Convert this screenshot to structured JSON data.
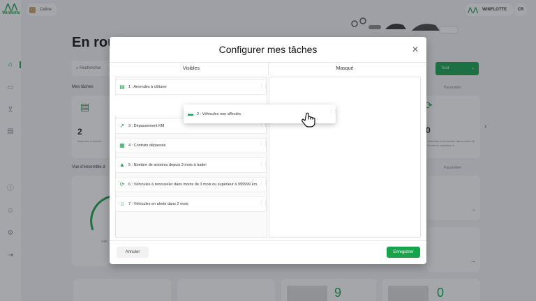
{
  "app": {
    "logo_text": "Winflotte",
    "company": "Celine",
    "user_name": "WINFLOTTE",
    "user_initials": "CR"
  },
  "background": {
    "title": "En rou",
    "search_placeholder": "Rechercher",
    "filter_value": "Tout",
    "section_tasks": "Mes tâches",
    "section_overview": "Vue d'ensemble d",
    "parametrer": "Paramétrer",
    "card1_number": "2",
    "card1_caption": "Amendes à clôturer",
    "card2_number": "0",
    "card2_caption": "Véhicules à renouveler dans moins de 3 mois ou supérieur à",
    "gauge_label": "Véh",
    "stat1_number": "9",
    "stat2_number": "0"
  },
  "modal": {
    "title": "Configurer mes tâches",
    "close_icon": "close-icon",
    "col_visible": "Visibles",
    "col_hidden": "Masqué",
    "cancel_label": "Annuler",
    "save_label": "Enregistrer",
    "visible_tasks": [
      {
        "label": "1 : Amendes à clôturer",
        "icon": "document-check-icon"
      },
      {
        "label": "3 : Dépassement KM",
        "icon": "trend-up-icon"
      },
      {
        "label": "4 : Contrats dépassés",
        "icon": "contract-icon"
      },
      {
        "label": "5 : Nombre de sinistres depuis 3 mois à traiter",
        "icon": "accident-icon"
      },
      {
        "label": "6 : Véhicules à renouveler dans moins de 3 mois ou supérieur à 999999 km.",
        "icon": "renew-icon"
      },
      {
        "label": "7 : Véhicules en alerte dans 2 mois",
        "icon": "bell-icon"
      }
    ],
    "dragged_task": {
      "label": "2 : Véhicules non affectés",
      "icon": "car-icon"
    }
  },
  "colors": {
    "accent": "#16a34a"
  }
}
